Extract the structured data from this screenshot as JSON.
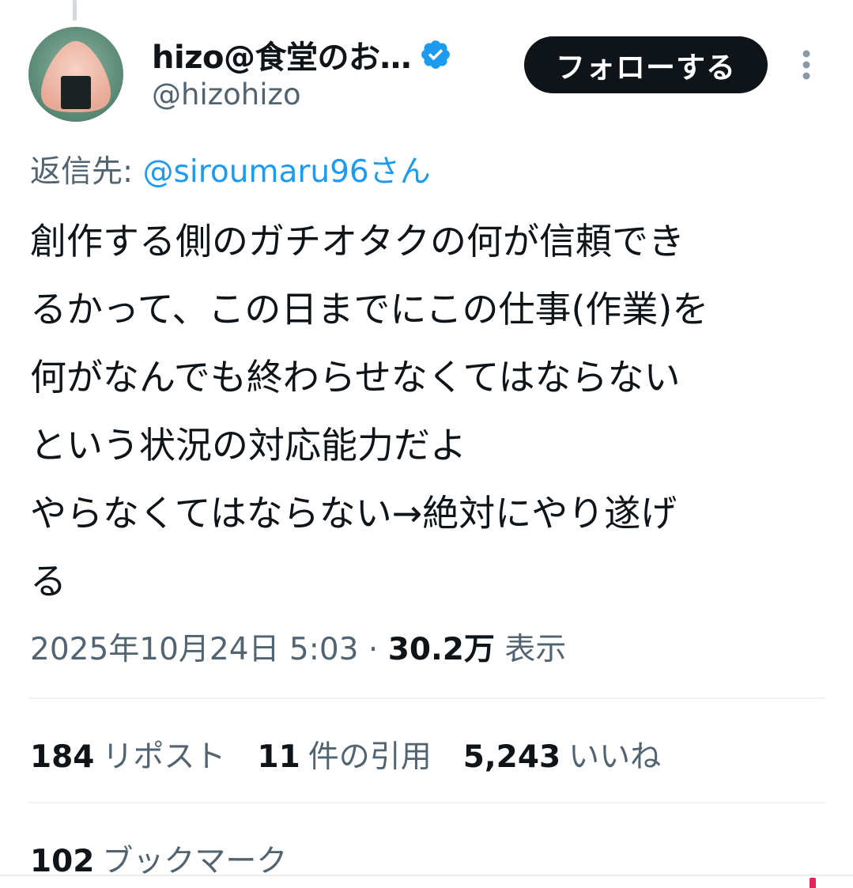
{
  "author": {
    "display_name": "hizo@食堂のお…",
    "handle": "@hizohizo",
    "verified": true
  },
  "follow_label": "フォローする",
  "reply_to": {
    "prefix": "返信先: ",
    "mention": "@siroumaru96さん"
  },
  "tweet": {
    "lines": [
      "創作する側のガチオタクの何が信頼でき",
      "るかって、この日までにこの仕事(作業)を",
      "何がなんでも終わらせなくてはならない",
      "という状況の対応能力だよ",
      "やらなくてはならない→絶対にやり遂げ",
      "る"
    ]
  },
  "meta": {
    "timestamp": "2025年10月24日 5:03",
    "separator": " · ",
    "views_count": "30.2万",
    "views_label": "表示"
  },
  "stats": {
    "reposts_count": "184",
    "reposts_label": "リポスト",
    "quotes_count": "11",
    "quotes_label": "件の引用",
    "likes_count": "5,243",
    "likes_label": "いいね",
    "bookmarks_count": "102",
    "bookmarks_label": "ブックマーク"
  },
  "colors": {
    "accent": "#1d9bf0",
    "text_primary": "#0f1419",
    "text_secondary": "#536471",
    "follow_button_bg": "#0f1419"
  }
}
